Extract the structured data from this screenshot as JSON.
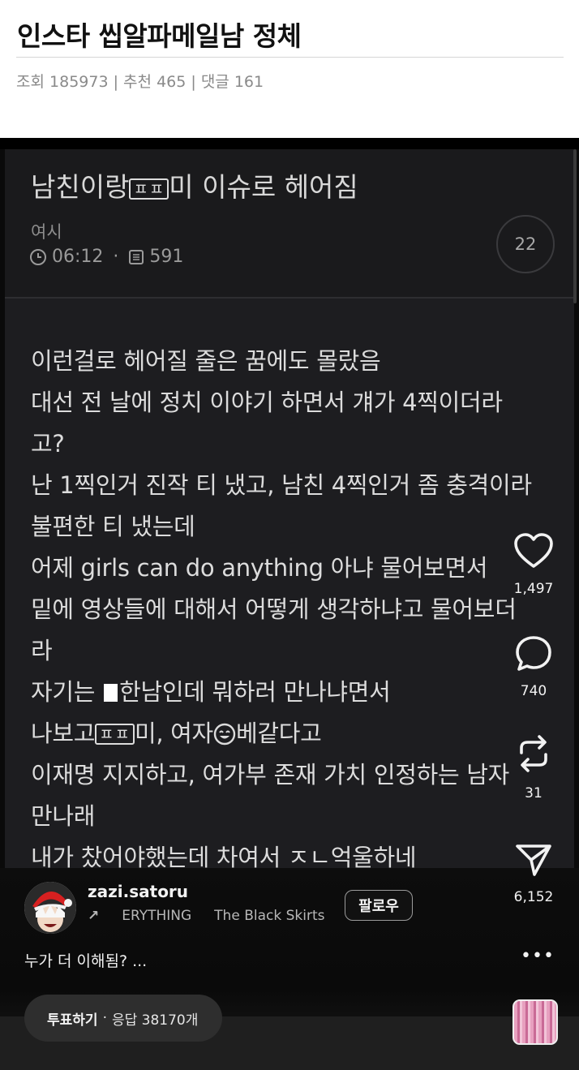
{
  "post": {
    "title": "인스타 씹알파메일남 정체",
    "meta": {
      "views_label": "조회",
      "views": "185973",
      "recommend_label": "추천",
      "recommend": "465",
      "comments_label": "댓글",
      "comments": "161",
      "separator": "|"
    }
  },
  "card": {
    "title_before": "남친이랑",
    "title_badge": "ㅍㅍ",
    "title_after": "미 이슈로 헤어짐",
    "author": "여시",
    "time": "06:12",
    "dot": "·",
    "views": "591",
    "comment_count": "22",
    "body": {
      "line1": "이런걸로 헤어질 줄은 꿈에도 몰랐음",
      "line2": "대선 전 날에 정치 이야기 하면서 걔가 4찍이더라",
      "line3": "고?",
      "line4": "난 1찍인거 진작 티 냈고, 남친 4찍인거 좀 충격이라",
      "line5": "불편한 티 냈는데",
      "line6": "어제 girls can do anything 아냐 물어보면서",
      "line7": "밑에 영상들에 대해서 어떻게 생각하냐고 물어보더",
      "line8": "라",
      "line9_before": "자기는",
      "line9_after": "한남인데 뭐하러 만나냐면서",
      "line10_before": "나보고",
      "line10_badge": "ㅍㅍ",
      "line10_mid": "미, 여자",
      "line10_after": "베같다고",
      "line11": "이재명 지지하고, 여가부 존재 가치 인정하는 남자",
      "line12": "만나래",
      "line13": "내가 찼어야했는데 차여서 ㅈㄴ억울하네"
    }
  },
  "reel": {
    "username": "zazi.satoru",
    "music_track": "ERYTHING",
    "music_artist": "The Black Skirts",
    "follow_label": "팔로우",
    "caption": "누가 더 이해됨? ...",
    "poll_label": "투표하기",
    "poll_sep": "·",
    "poll_responses": "응답 38170개",
    "more": "•••",
    "actions": {
      "likes": "1,497",
      "comments": "740",
      "reposts": "31",
      "shares": "6,152"
    }
  },
  "icons": [
    "heart-icon",
    "comment-icon",
    "repost-icon",
    "send-icon",
    "clock-icon",
    "views-icon",
    "more-icon",
    "music-arrow-icon"
  ]
}
